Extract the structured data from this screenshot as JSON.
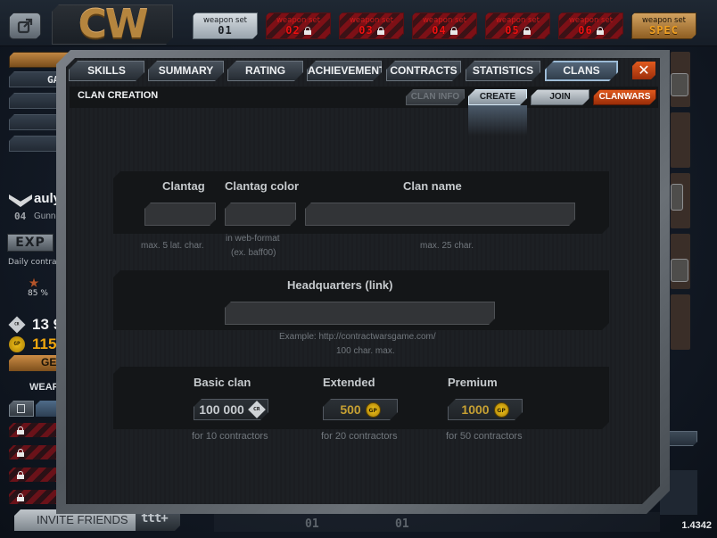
{
  "header": {
    "logo_text": "CW",
    "weapon_sets": [
      {
        "label": "weapon set",
        "number": "01",
        "state": "active"
      },
      {
        "label": "weapon set",
        "number": "02",
        "state": "locked"
      },
      {
        "label": "weapon set",
        "number": "03",
        "state": "locked"
      },
      {
        "label": "weapon set",
        "number": "04",
        "state": "locked"
      },
      {
        "label": "weapon set",
        "number": "05",
        "state": "locked"
      },
      {
        "label": "weapon set",
        "number": "06",
        "state": "locked"
      },
      {
        "label": "weapon set",
        "number": "SPEC",
        "state": "special"
      }
    ]
  },
  "sidebar": {
    "menu_item_partial": "GA",
    "player": {
      "name": "auly",
      "level": "04",
      "role": "Gunne"
    },
    "exp_badge": "EXP",
    "daily_contract_label": "Daily contrac",
    "daily_progress": "85 %",
    "currency_cr": "13 9",
    "currency_gp": "115",
    "get_button": "GE",
    "weapons_label": "WEAPO",
    "invite_friends": "INVITE FRIENDS",
    "invite_add_icon": "ttt+"
  },
  "modal": {
    "tabs": [
      {
        "label": "SKILLS",
        "active": false
      },
      {
        "label": "SUMMARY",
        "active": false
      },
      {
        "label": "RATING",
        "active": false
      },
      {
        "label": "ACHIEVEMENTS",
        "active": false
      },
      {
        "label": "CONTRACTS",
        "active": false
      },
      {
        "label": "STATISTICS",
        "active": false
      },
      {
        "label": "CLANS",
        "active": true
      }
    ],
    "close_icon": "✕",
    "section_title": "CLAN CREATION",
    "sub_tabs": [
      {
        "label": "CLAN INFO",
        "state": "disabled"
      },
      {
        "label": "CREATE",
        "state": "active"
      },
      {
        "label": "JOIN",
        "state": "normal"
      },
      {
        "label": "CLANWARS",
        "state": "accent"
      }
    ],
    "form": {
      "clantag": {
        "label": "Clantag",
        "value": "",
        "hint": "max. 5 lat. char."
      },
      "clantag_color": {
        "label": "Clantag color",
        "value": "",
        "hint_line1": "in web-format",
        "hint_line2": "(ex. baff00)"
      },
      "clan_name": {
        "label": "Clan name",
        "value": "",
        "hint": "max. 25 char."
      },
      "headquarters": {
        "label": "Headquarters (link)",
        "value": "",
        "hint_line1": "Example: http://contractwarsgame.com/",
        "hint_line2": "100 char. max."
      }
    },
    "plans": [
      {
        "name": "Basic clan",
        "price": "100 000",
        "currency": "CR",
        "note": "for 10 contractors"
      },
      {
        "name": "Extended",
        "price": "500",
        "currency": "GP",
        "note": "for 20 contractors"
      },
      {
        "name": "Premium",
        "price": "1000",
        "currency": "GP",
        "note": "for 50 contractors"
      }
    ]
  },
  "footer": {
    "slot_left": "01",
    "slot_right": "01",
    "version": "1.4342"
  },
  "colors": {
    "accent_orange": "#d9521a",
    "gold": "#c6a033",
    "locked_red": "#7d1016",
    "active_blue": "#a7c1d9"
  }
}
